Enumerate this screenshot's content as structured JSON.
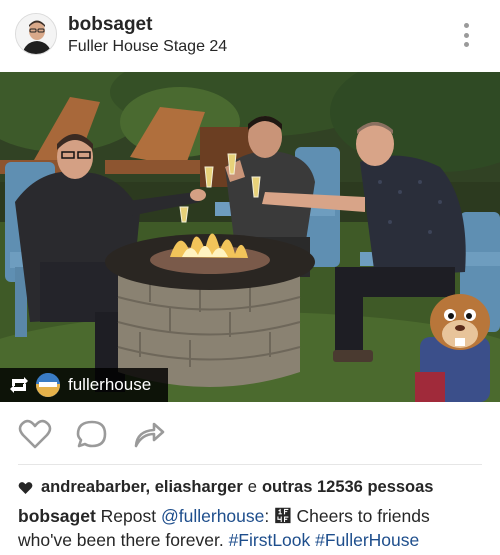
{
  "header": {
    "username": "bobsaget",
    "location": "Fuller House Stage 24",
    "avatar_icon": "profile-avatar",
    "more_icon": "more-vertical-icon"
  },
  "photo": {
    "repost_username": "fullerhouse"
  },
  "actions": {
    "like_icon": "heart-outline-icon",
    "comment_icon": "comment-bubble-icon",
    "share_icon": "share-arrow-icon"
  },
  "likes": {
    "names": "andreabarber, eliasharger",
    "conjunction": "e",
    "others": "outras 12536 pessoas"
  },
  "caption": {
    "username": "bobsaget",
    "text_start": "Repost",
    "mention": "@fullerhouse",
    "text_mid": ": ὏ Cheers to friends who've been there forever.",
    "hashtag1": "#FirstLook",
    "hashtag2": "#FullerHouse"
  },
  "colors": {
    "link": "#1e4e8c",
    "text": "#262626",
    "icon_gray": "#9a9a9a"
  }
}
